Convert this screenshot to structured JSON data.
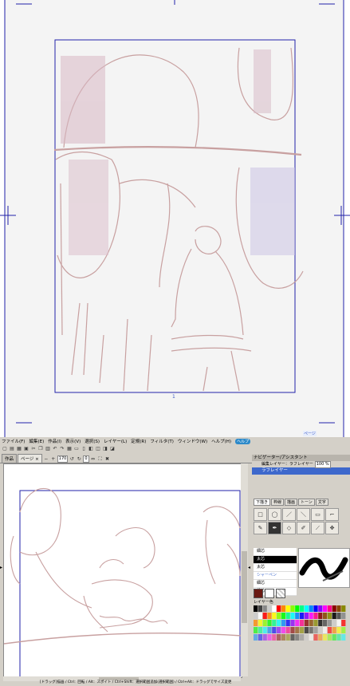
{
  "preview": {
    "page_number": "1",
    "page_tab_label": "ページ"
  },
  "menubar": [
    {
      "label": "ファイル(F)"
    },
    {
      "label": "編集(E)"
    },
    {
      "label": "作品(I)"
    },
    {
      "label": "表示(V)"
    },
    {
      "label": "選択(S)"
    },
    {
      "label": "レイヤー(L)"
    },
    {
      "label": "定規(R)"
    },
    {
      "label": "フィルタ(T)"
    },
    {
      "label": "ウィンドウ(W)"
    },
    {
      "label": "ヘルプ(H)"
    }
  ],
  "help_badge": "ヘルプ",
  "toolbar": {
    "zoom_value": "170",
    "rotate_value": "0"
  },
  "doc_tabs": [
    {
      "label": "作品"
    },
    {
      "label": "ページ ×"
    }
  ],
  "panel": {
    "navigator_title": "ナビゲーター/アシスタント",
    "edit_layer_label": "編集レイヤー：ラフレイヤー",
    "zoom_value": "100 %",
    "layer_name": "ラフレイヤー",
    "tool_tabs": [
      "下描き",
      "枠線",
      "描画",
      "トーン",
      "文字"
    ],
    "tools": [
      "□",
      "◯",
      "／",
      "＼",
      "▭",
      "⌐",
      "✎",
      "✒",
      "◇",
      "✐",
      "⟋",
      "✥"
    ],
    "brushes": [
      {
        "label": "細芯"
      },
      {
        "label": "太芯"
      },
      {
        "label": "太芯"
      },
      {
        "label": "シャーペン"
      },
      {
        "label": "細芯"
      },
      {
        "label": "鉛芯"
      }
    ],
    "palette_label": "レイヤー色",
    "main_color": "#6b1a12",
    "sub_color": "#ffffff"
  },
  "statusbar": "[ドラッグ]描画 / Ctrl：回転 / Alt：スポイト / Ctrl+Shift：選択範囲追加(選択範囲) / Ctrl+Alt：ドラッグでサイズ変更",
  "colors": {
    "guide_blue": "#2222aa",
    "sketch_line": "#c8a0a0",
    "selection_blue": "#3d68cc"
  }
}
